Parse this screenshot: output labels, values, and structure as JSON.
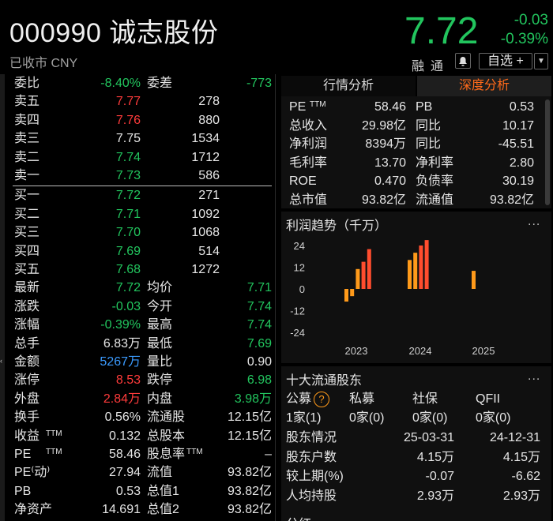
{
  "header": {
    "title": "000990 诚志股份",
    "status": "已收市 CNY",
    "price": "7.72",
    "change": "-0.03",
    "change_pct": "-0.39%",
    "rongtong": "融通",
    "watch_label": "自选 +"
  },
  "left": {
    "top": [
      {
        "l": "委比",
        "v": "-8.40%",
        "l2": "委差",
        "v2": "-773"
      }
    ],
    "asks": [
      {
        "l": "卖五",
        "p": "7.77",
        "v": "278"
      },
      {
        "l": "卖四",
        "p": "7.76",
        "v": "880"
      },
      {
        "l": "卖三",
        "p": "7.75",
        "v": "1534"
      },
      {
        "l": "卖二",
        "p": "7.74",
        "v": "1712"
      },
      {
        "l": "卖一",
        "p": "7.73",
        "v": "586"
      }
    ],
    "bids": [
      {
        "l": "买一",
        "p": "7.72",
        "v": "271"
      },
      {
        "l": "买二",
        "p": "7.71",
        "v": "1092"
      },
      {
        "l": "买三",
        "p": "7.70",
        "v": "1068"
      },
      {
        "l": "买四",
        "p": "7.69",
        "v": "514"
      },
      {
        "l": "买五",
        "p": "7.68",
        "v": "1272"
      }
    ],
    "stats": [
      {
        "l": "最新",
        "v": "7.72",
        "l2": "均价",
        "v2": "7.71"
      },
      {
        "l": "涨跌",
        "v": "-0.03",
        "l2": "今开",
        "v2": "7.74"
      },
      {
        "l": "涨幅",
        "v": "-0.39%",
        "l2": "最高",
        "v2": "7.74"
      },
      {
        "l": "总手",
        "v": "6.83万",
        "l2": "最低",
        "v2": "7.69"
      },
      {
        "l": "金额",
        "v": "5267万",
        "l2": "量比",
        "v2": "0.90"
      },
      {
        "l": "涨停",
        "v": "8.53",
        "l2": "跌停",
        "v2": "6.98"
      },
      {
        "l": "外盘",
        "v": "2.84万",
        "l2": "内盘",
        "v2": "3.98万"
      },
      {
        "l": "换手",
        "v": "0.56%",
        "l2": "流通股",
        "v2": "12.15亿"
      },
      {
        "l": "收益",
        "sup": "TTM",
        "v": "0.132",
        "l2": "总股本",
        "v2": "12.15亿"
      },
      {
        "l": "PE ",
        "sup": "TTM",
        "v": "58.46",
        "l2": "股息率",
        "sup2": "TTM",
        "v2": "–"
      },
      {
        "l": "PE⁽动⁾",
        "v": "27.94",
        "l2": "流值",
        "v2": "93.82亿"
      },
      {
        "l": "PB",
        "v": "0.53",
        "l2": "总值1",
        "v2": "93.82亿"
      },
      {
        "l": "净资产",
        "v": "14.691",
        "l2": "总值2",
        "v2": "93.82亿"
      }
    ]
  },
  "right": {
    "tabs": [
      "行情分析",
      "深度分析"
    ],
    "fin": [
      {
        "a": "PE",
        "sup": "TTM",
        "b": "58.46",
        "c": "PB",
        "d": "0.53"
      },
      {
        "a": "总收入",
        "b": "29.98亿",
        "c": "同比",
        "d": "10.17"
      },
      {
        "a": "净利润",
        "b": "8394万",
        "c": "同比",
        "d": "-45.51"
      },
      {
        "a": "毛利率",
        "b": "13.70",
        "c": "净利率",
        "d": "2.80"
      },
      {
        "a": "ROE",
        "b": "0.470",
        "c": "负债率",
        "d": "30.19"
      },
      {
        "a": "总市值",
        "b": "93.82亿",
        "c": "流通值",
        "d": "93.82亿"
      }
    ],
    "profit_title": "利润趋势（千万）",
    "more": "...",
    "holders": {
      "title": "十大流通股东",
      "cats": [
        "公募",
        "私募",
        "社保",
        "QFII"
      ],
      "counts": [
        "1家(1)",
        "0家(0)",
        "0家(0)",
        "0家(0)"
      ],
      "rows": [
        {
          "l": "股东情况",
          "a": "25-03-31",
          "b": "24-12-31"
        },
        {
          "l": "股东户数",
          "a": "4.15万",
          "b": "4.15万"
        },
        {
          "l": "较上期(%)",
          "a": "-0.07",
          "b": "-6.62"
        },
        {
          "l": "人均持股",
          "a": "2.93万",
          "b": "2.93万"
        }
      ],
      "next_title": "分红"
    }
  },
  "chart_data": {
    "type": "bar",
    "title": "利润趋势（千万）",
    "yticks": [
      24,
      12,
      0,
      -12,
      -24
    ],
    "ylim": [
      -24,
      24
    ],
    "xticks": [
      "2023",
      "2024",
      "2025"
    ],
    "series": [
      {
        "values": [
          -7,
          -4,
          11,
          15,
          22
        ],
        "year": "2023"
      },
      {
        "values": [
          16,
          20,
          24,
          27
        ],
        "year": "2024"
      },
      {
        "values": [
          10
        ],
        "year": "2025"
      }
    ],
    "colors": {
      "pos_red": "#ff4d2e",
      "pos_orange": "#ff9a1a",
      "neg": "#ff9a1a"
    }
  }
}
